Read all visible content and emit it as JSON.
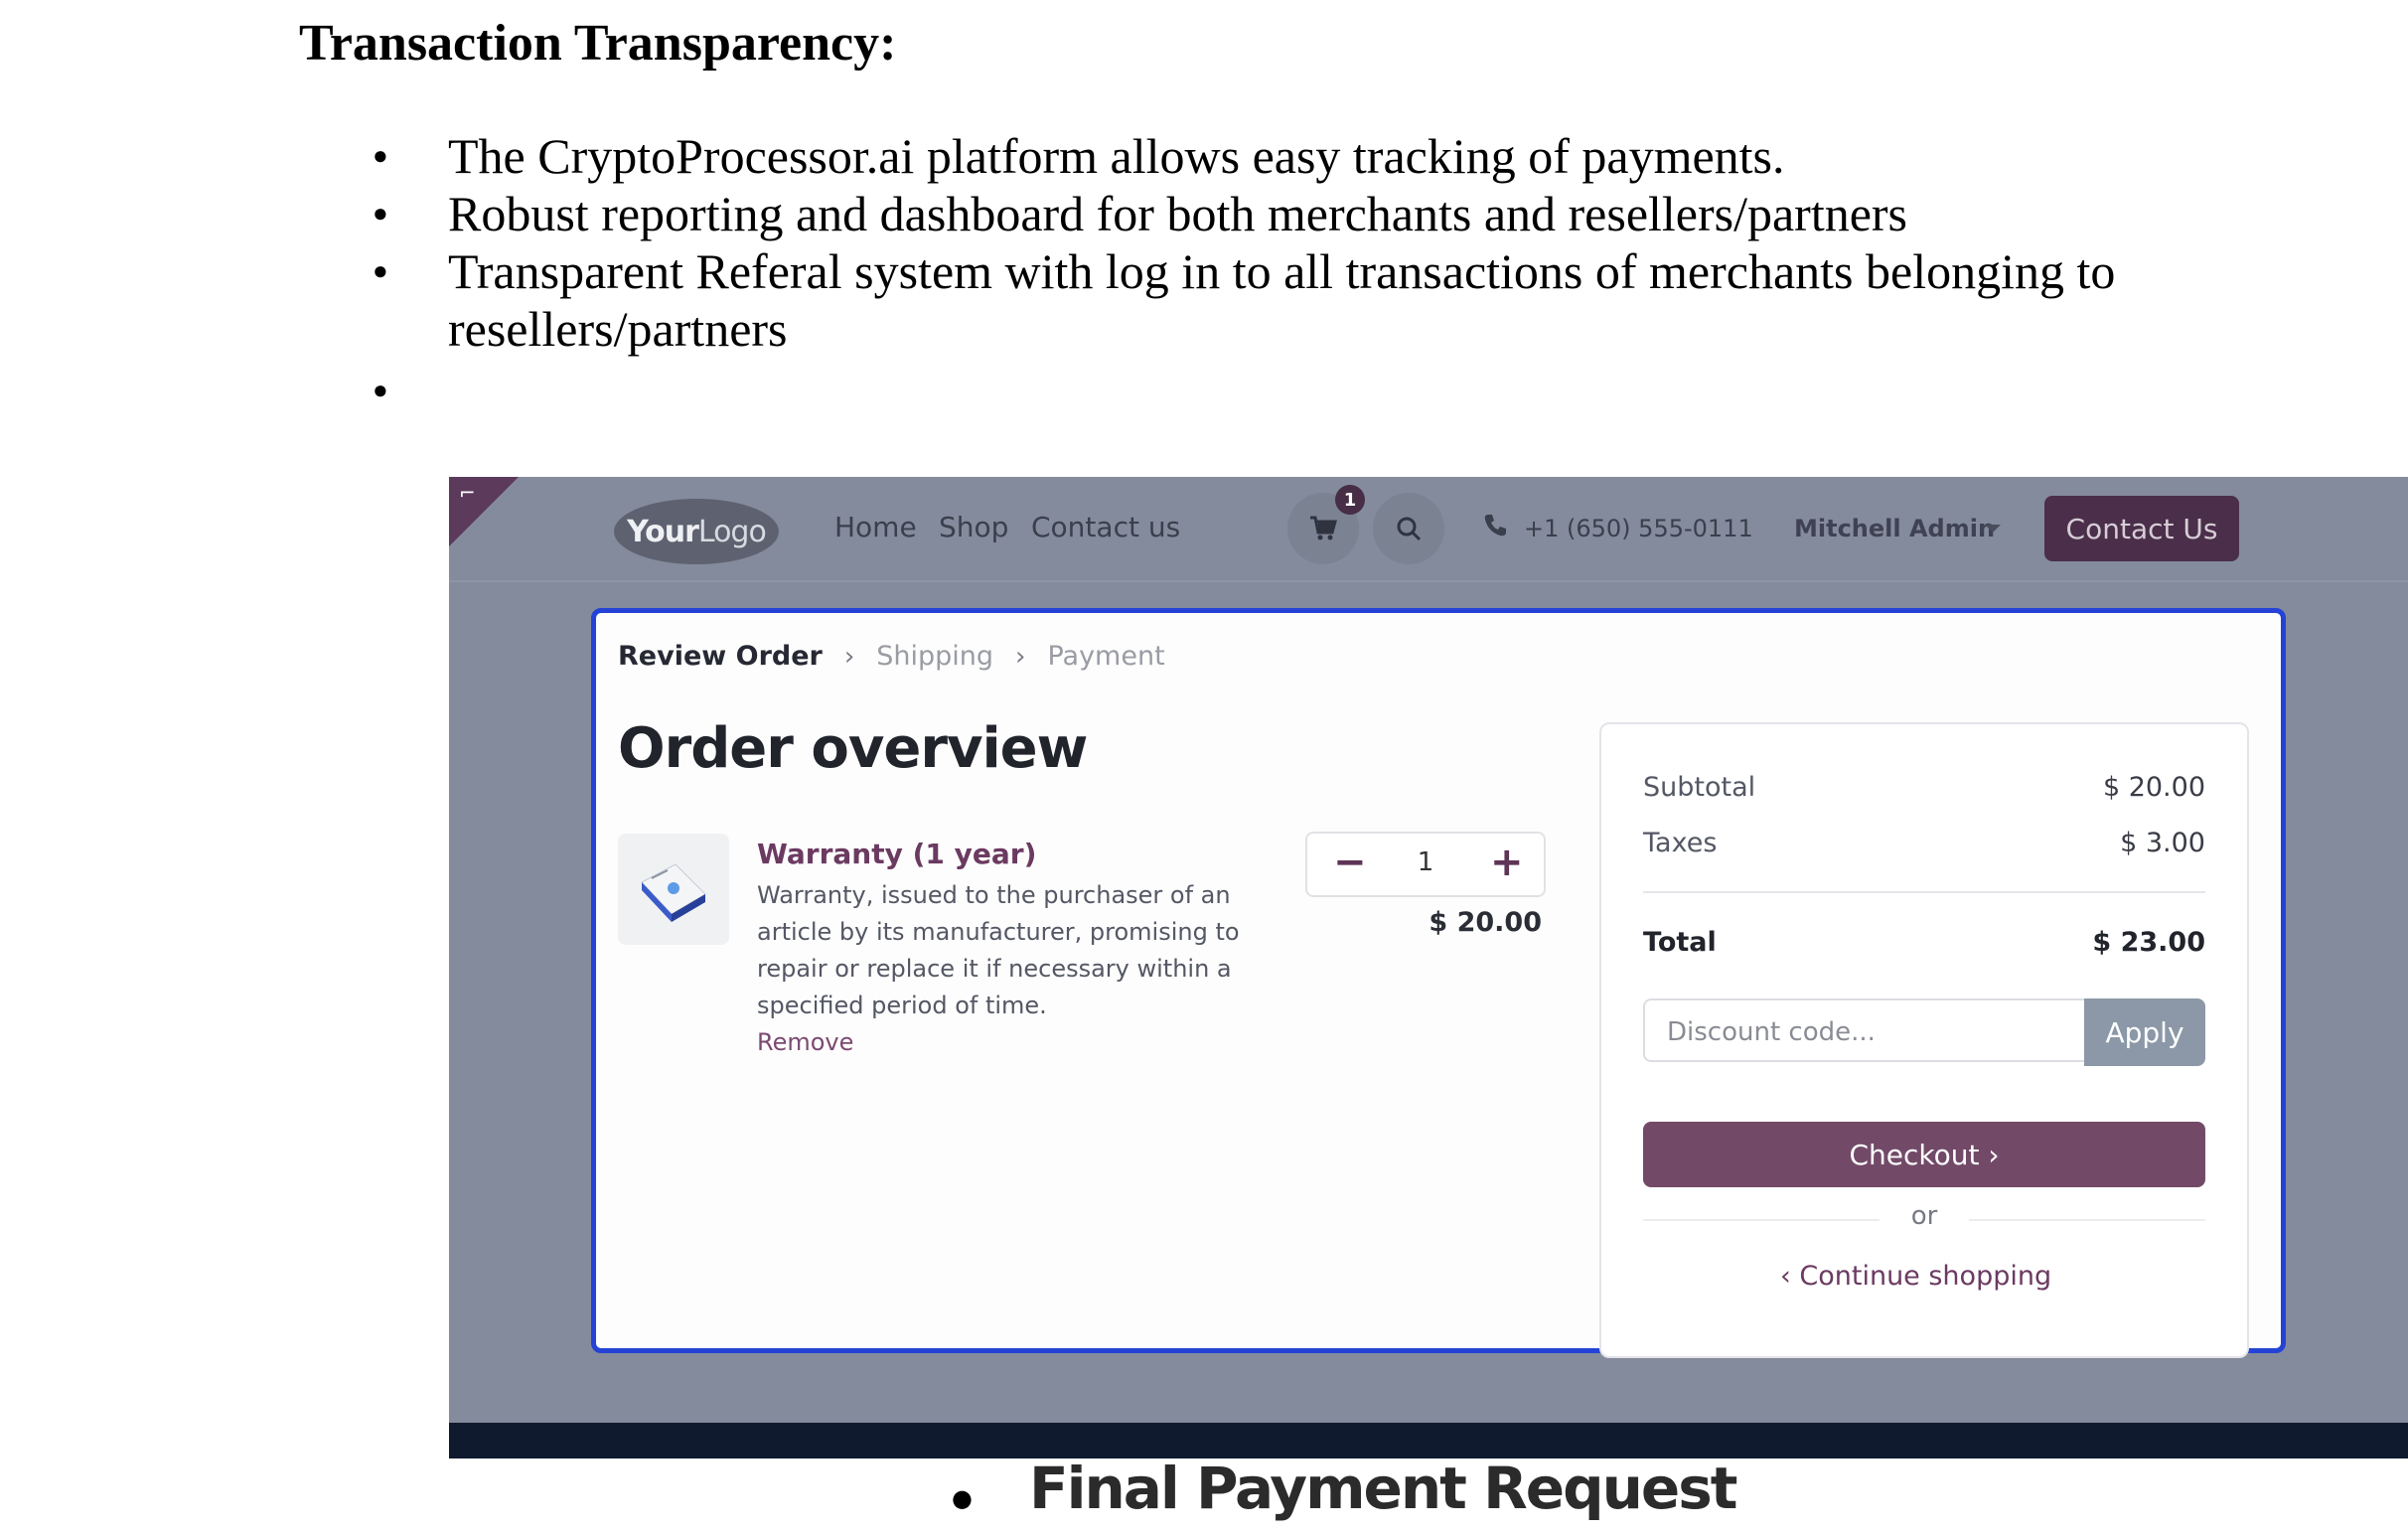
{
  "document": {
    "heading": "Transaction Transparency:",
    "bullets": [
      "The CryptoProcessor.ai platform allows easy tracking of payments.",
      "Robust reporting and dashboard for both merchants and resellers/partners",
      "Transparent Referal system with log in to all transactions of merchants belonging to resellers/partners"
    ],
    "bullet_glyph": "●",
    "final_heading": "Final Payment Request"
  },
  "screenshot": {
    "corner_glyph": "⌐",
    "navbar": {
      "logo_bold": "Your",
      "logo_light": "Logo",
      "links": [
        "Home",
        "Shop",
        "Contact us"
      ],
      "cart_count": "1",
      "phone": "+1 (650) 555-0111",
      "user": "Mitchell Admin",
      "contact_button": "Contact Us"
    },
    "breadcrumb": {
      "steps": [
        "Review Order",
        "Shipping",
        "Payment"
      ],
      "separator": "›"
    },
    "title": "Order overview",
    "product": {
      "name": "Warranty (1 year)",
      "description": "Warranty, issued to the purchaser of an article by its manufacturer, promising to repair or replace it if necessary within a specified period of time.",
      "remove": "Remove",
      "quantity": "1",
      "minus": "−",
      "plus": "+",
      "price": "$ 20.00"
    },
    "summary": {
      "subtotal_label": "Subtotal",
      "subtotal_value": "$ 20.00",
      "taxes_label": "Taxes",
      "taxes_value": "$ 3.00",
      "total_label": "Total",
      "total_value": "$ 23.00",
      "discount_placeholder": "Discount code...",
      "apply": "Apply",
      "checkout": "Checkout  ›",
      "or": "or",
      "continue": "‹  Continue shopping"
    },
    "colors": {
      "overlay": "#848b9c",
      "panel_border": "#2443d6",
      "brand": "#724a68",
      "contact_button": "#4b2f4a",
      "bottom_bar": "#0f1a2e"
    },
    "icons": [
      "cart-icon",
      "search-icon",
      "phone-icon",
      "chevron-right-icon",
      "chevron-left-icon",
      "caret-down-icon"
    ]
  }
}
